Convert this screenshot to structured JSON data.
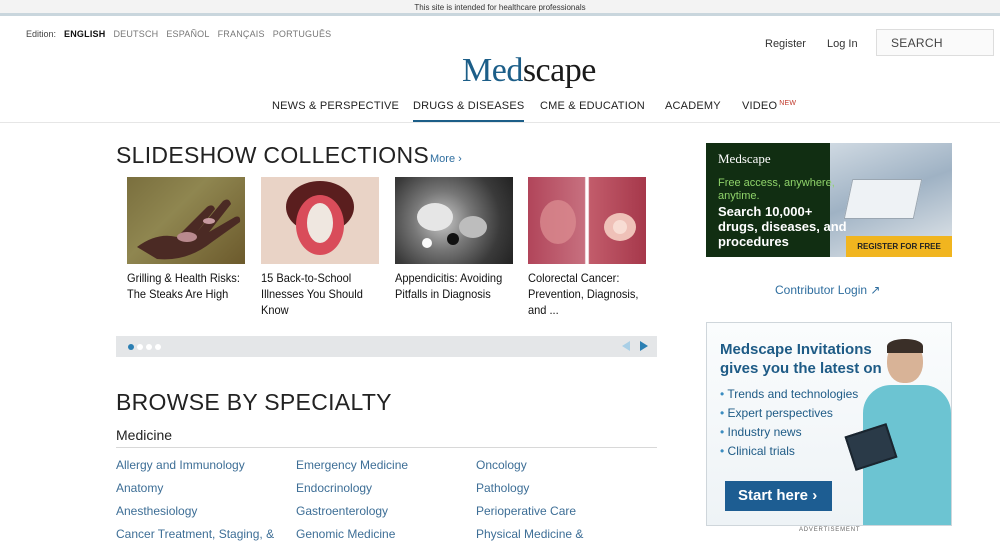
{
  "topbar": {
    "notice": "This site is intended for healthcare professionals"
  },
  "edition": {
    "label": "Edition:",
    "languages": [
      "ENGLISH",
      "DEUTSCH",
      "ESPAÑOL",
      "FRANÇAIS",
      "PORTUGUÊS"
    ]
  },
  "header": {
    "register": "Register",
    "login": "Log In",
    "search_placeholder": "SEARCH",
    "logo_part1": "Med",
    "logo_part2": "scape"
  },
  "nav": {
    "items": [
      {
        "label": "NEWS & PERSPECTIVE"
      },
      {
        "label": "DRUGS & DISEASES"
      },
      {
        "label": "CME & EDUCATION"
      },
      {
        "label": "ACADEMY"
      },
      {
        "label": "VIDEO",
        "badge": "NEW"
      }
    ]
  },
  "slideshow": {
    "heading": "SLIDESHOW COLLECTIONS",
    "more": "More ›",
    "cards": [
      {
        "title": "Grilling & Health Risks: The Steaks Are High",
        "image": "burned-hand-photo"
      },
      {
        "title": "15 Back-to-School Illnesses You Should Know",
        "image": "tongue-photo"
      },
      {
        "title": "Appendicitis: Avoiding Pitfalls in Diagnosis",
        "image": "ct-scan-photo"
      },
      {
        "title": "Colorectal Cancer: Prevention, Diagnosis, and ...",
        "image": "colonoscopy-photo"
      }
    ]
  },
  "browse": {
    "heading": "BROWSE BY SPECIALTY",
    "section": "Medicine",
    "columns": [
      [
        "Allergy and Immunology",
        "Anatomy",
        "Anesthesiology",
        "Cancer Treatment, Staging, &"
      ],
      [
        "Emergency Medicine",
        "Endocrinology",
        "Gastroenterology",
        "Genomic Medicine"
      ],
      [
        "Oncology",
        "Pathology",
        "Perioperative Care",
        "Physical Medicine &"
      ]
    ]
  },
  "ad_access": {
    "logo": "Medscape",
    "free_text": "Free access, anywhere, anytime.",
    "main_text": "Search 10,000+ drugs, diseases, and procedures",
    "cta": "REGISTER FOR FREE"
  },
  "contributor": {
    "label": "Contributor Login ↗"
  },
  "ad_invitations": {
    "title": "Medscape Invitations gives you the latest on",
    "bullets": [
      "Trends and technologies",
      "Expert perspectives",
      "Industry news",
      "Clinical trials"
    ],
    "button": "Start here ›"
  },
  "advertisement_label": "ADVERTISEMENT"
}
